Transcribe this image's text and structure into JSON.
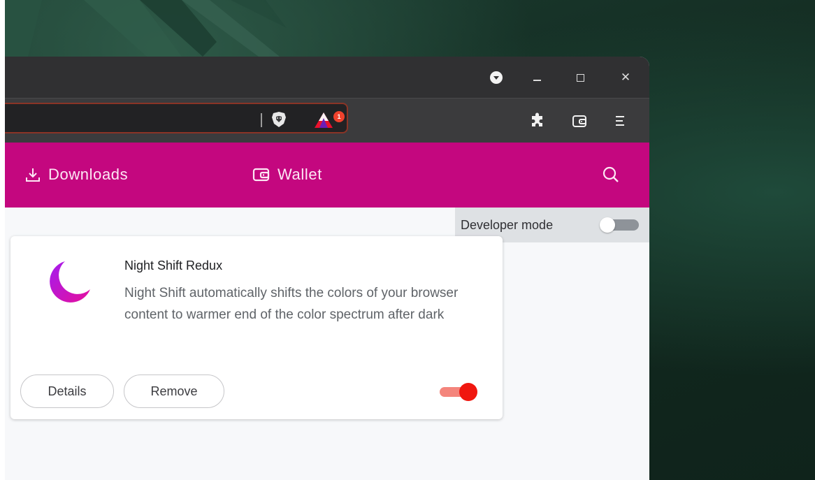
{
  "navbar": {
    "downloads_label": "Downloads",
    "wallet_label": "Wallet"
  },
  "developer_mode": {
    "label": "Developer mode",
    "enabled": false
  },
  "extension": {
    "name": "Night Shift Redux",
    "description": "Night Shift automatically shifts the colors of your browser content to warmer end of the color spectrum after dark",
    "details_label": "Details",
    "remove_label": "Remove",
    "enabled": true
  },
  "toolbar": {
    "rewards_badge": "1"
  },
  "colors": {
    "brand_pink": "#c4077f",
    "toggle_on": "#f0170f",
    "titlebar": "#303032"
  },
  "icons": [
    "profile-dropdown-icon",
    "minimize-icon",
    "maximize-icon",
    "close-icon",
    "brave-shields-icon",
    "brave-rewards-icon",
    "extensions-puzzle-icon",
    "wallet-icon",
    "menu-icon",
    "download-icon",
    "search-icon",
    "moon-icon"
  ]
}
